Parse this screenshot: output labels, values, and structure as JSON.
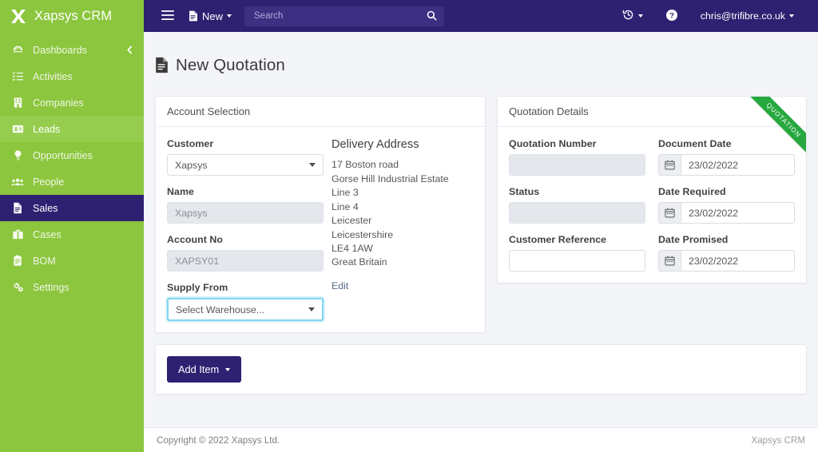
{
  "brand": {
    "name": "Xapsys CRM",
    "logo_icon": "x-logo-icon"
  },
  "sidebar": {
    "collapse_icon": "chevron-left-icon",
    "items": [
      {
        "label": "Dashboards",
        "icon": "dashboard-icon",
        "state": "normal"
      },
      {
        "label": "Activities",
        "icon": "list-check-icon",
        "state": "normal"
      },
      {
        "label": "Companies",
        "icon": "building-icon",
        "state": "normal"
      },
      {
        "label": "Leads",
        "icon": "id-card-icon",
        "state": "hover"
      },
      {
        "label": "Opportunities",
        "icon": "lightbulb-icon",
        "state": "normal"
      },
      {
        "label": "People",
        "icon": "users-icon",
        "state": "normal"
      },
      {
        "label": "Sales",
        "icon": "file-text-icon",
        "state": "active"
      },
      {
        "label": "Cases",
        "icon": "briefcase-icon",
        "state": "normal"
      },
      {
        "label": "BOM",
        "icon": "clipboard-icon",
        "state": "normal"
      },
      {
        "label": "Settings",
        "icon": "gears-icon",
        "state": "normal"
      }
    ]
  },
  "topbar": {
    "menu_icon": "hamburger-icon",
    "new_label": "New",
    "new_icon": "document-icon",
    "search": {
      "placeholder": "Search",
      "value": "",
      "icon": "search-icon"
    },
    "history_icon": "history-clock-icon",
    "help_icon": "question-circle-icon",
    "user_email": "chris@trifibre.co.uk"
  },
  "page": {
    "title": "New Quotation",
    "title_icon": "document-icon"
  },
  "account_selection": {
    "heading": "Account Selection",
    "customer": {
      "label": "Customer",
      "value": "Xapsys"
    },
    "name": {
      "label": "Name",
      "value": "Xapsys"
    },
    "account_no": {
      "label": "Account No",
      "value": "XAPSY01"
    },
    "supply_from": {
      "label": "Supply From",
      "value": "Select Warehouse..."
    },
    "delivery_address": {
      "title": "Delivery Address",
      "lines": [
        "17 Boston road",
        "Gorse Hill Industrial Estate",
        "Line 3",
        "Line 4",
        "Leicester",
        "Leicestershire",
        "LE4 1AW",
        "Great Britain"
      ],
      "edit_label": "Edit"
    }
  },
  "quotation_details": {
    "heading": "Quotation Details",
    "ribbon": "QUOTATION",
    "ribbon_color": "#27a83f",
    "quotation_number": {
      "label": "Quotation Number",
      "value": ""
    },
    "status": {
      "label": "Status",
      "value": ""
    },
    "customer_reference": {
      "label": "Customer Reference",
      "value": ""
    },
    "document_date": {
      "label": "Document Date",
      "value": "23/02/2022",
      "icon": "calendar-icon"
    },
    "date_required": {
      "label": "Date Required",
      "value": "23/02/2022",
      "icon": "calendar-icon"
    },
    "date_promised": {
      "label": "Date Promised",
      "value": "23/02/2022",
      "icon": "calendar-icon"
    }
  },
  "items": {
    "add_item_label": "Add Item"
  },
  "footer": {
    "copyright": "Copyright © 2022 Xapsys Ltd.",
    "right": "Xapsys CRM"
  },
  "colors": {
    "brand_green": "#8cc63e",
    "brand_purple": "#2e2171",
    "accent_blue": "#81d4f0"
  }
}
